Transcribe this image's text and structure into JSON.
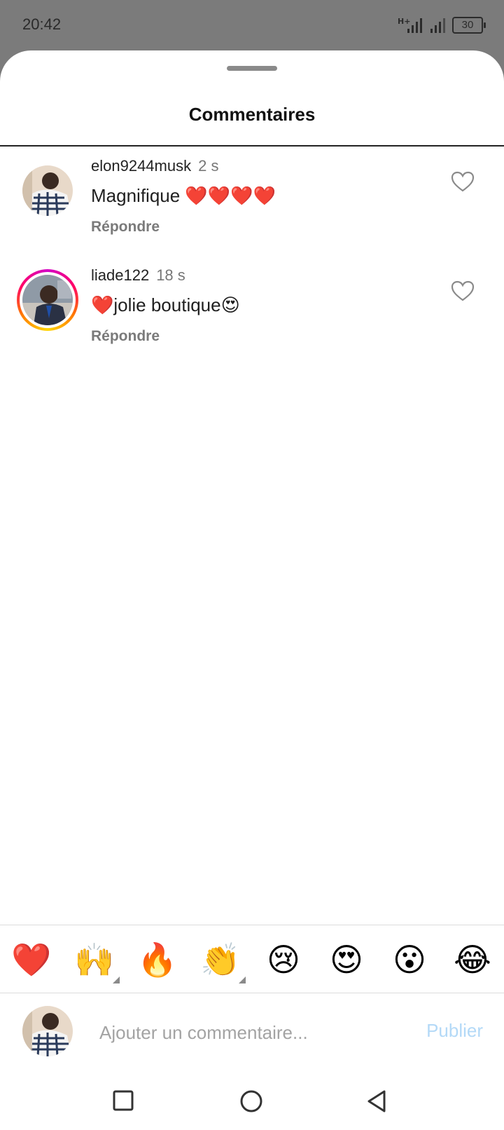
{
  "status_bar": {
    "time": "20:42",
    "network": "H+",
    "battery": "30"
  },
  "sheet": {
    "title": "Commentaires"
  },
  "comments": [
    {
      "username": "elon9244musk",
      "time": "2 s",
      "text": "Magnifique ❤️❤️❤️❤️",
      "reply_label": "Répondre",
      "has_story_ring": false
    },
    {
      "username": "liade122",
      "time": "18 s",
      "text": "❤️jolie boutique😍",
      "reply_label": "Répondre",
      "has_story_ring": true
    }
  ],
  "emoji_bar": [
    "❤️",
    "🙌",
    "🔥",
    "👏",
    "😢",
    "😍",
    "😮",
    "😂"
  ],
  "composer": {
    "placeholder": "Ajouter un commentaire...",
    "publish_label": "Publier"
  },
  "colors": {
    "publish_disabled": "#b3d9f7",
    "story_ring": "#d300c5"
  }
}
